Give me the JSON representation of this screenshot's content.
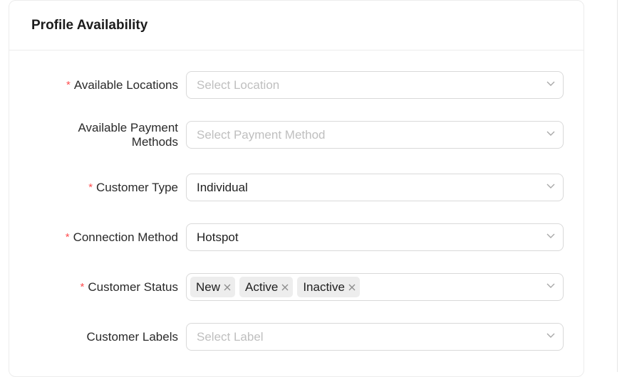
{
  "card": {
    "title": "Profile Availability"
  },
  "fields": {
    "locations": {
      "label": "Available Locations",
      "required": true,
      "placeholder": "Select Location"
    },
    "payment": {
      "label_line1": "Available Payment",
      "label_line2": "Methods",
      "required": false,
      "placeholder": "Select Payment Method"
    },
    "customer_type": {
      "label": "Customer Type",
      "required": true,
      "value": "Individual"
    },
    "connection_method": {
      "label": "Connection Method",
      "required": true,
      "value": "Hotspot"
    },
    "customer_status": {
      "label": "Customer Status",
      "required": true,
      "tags": [
        "New",
        "Active",
        "Inactive"
      ]
    },
    "customer_labels": {
      "label": "Customer Labels",
      "required": false,
      "placeholder": "Select Label"
    }
  },
  "required_marker": "*",
  "icons": {
    "dropdown": "chevron-down-icon",
    "remove": "close-icon"
  },
  "colors": {
    "required": "#ff4d4f",
    "placeholder": "#bfbfbf",
    "border": "#d9d9d9",
    "tag_bg": "#ededed"
  }
}
